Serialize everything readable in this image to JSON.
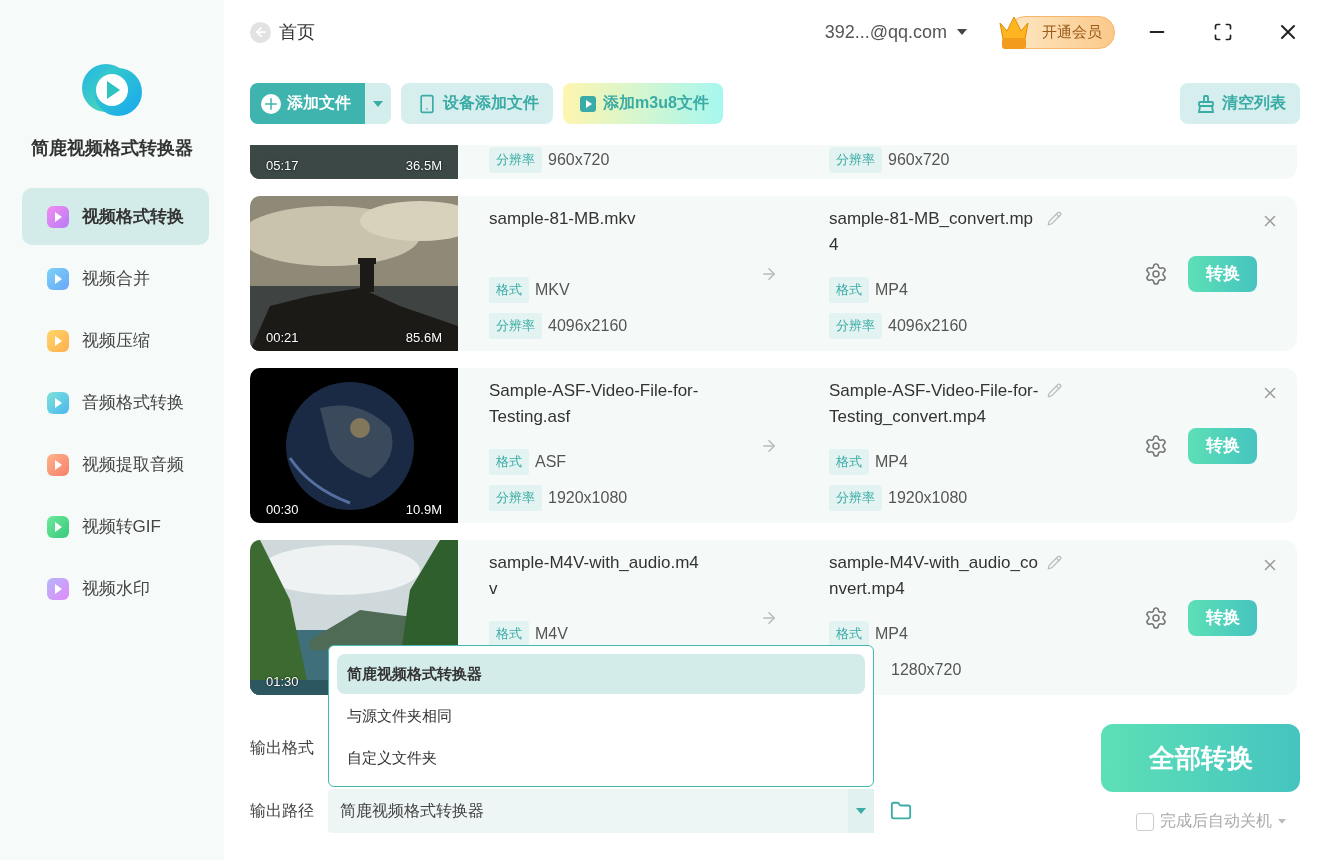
{
  "app": {
    "name": "简鹿视频格式转换器"
  },
  "sidebar": {
    "items": [
      {
        "label": "视频格式转换",
        "selected": true
      },
      {
        "label": "视频合并",
        "selected": false
      },
      {
        "label": "视频压缩",
        "selected": false
      },
      {
        "label": "音频格式转换",
        "selected": false
      },
      {
        "label": "视频提取音频",
        "selected": false
      },
      {
        "label": "视频转GIF",
        "selected": false
      },
      {
        "label": "视频水印",
        "selected": false
      }
    ]
  },
  "topbar": {
    "back_label": "首页",
    "account": "392...@qq.com",
    "vip_label": "开通会员"
  },
  "toolbar": {
    "add_file": "添加文件",
    "add_device": "设备添加文件",
    "add_m3u8": "添加m3u8文件",
    "clear": "清空列表"
  },
  "files": [
    {
      "kind": "clipped",
      "duration": "05:17",
      "size": "36.5M",
      "source": {
        "resolution_tag": "分辨率",
        "resolution": "960x720"
      },
      "target": {
        "resolution_tag": "分辨率",
        "resolution": "960x720"
      }
    },
    {
      "kind": "full",
      "duration": "00:21",
      "size": "85.6M",
      "source": {
        "name": "sample-81-MB.mkv",
        "format_tag": "格式",
        "format": "MKV",
        "resolution_tag": "分辨率",
        "resolution": "4096x2160"
      },
      "target": {
        "name": "sample-81-MB_convert.mp4",
        "format_tag": "格式",
        "format": "MP4",
        "resolution_tag": "分辨率",
        "resolution": "4096x2160"
      },
      "convert_label": "转换"
    },
    {
      "kind": "full",
      "duration": "00:30",
      "size": "10.9M",
      "source": {
        "name": "Sample-ASF-Video-File-for-Testing.asf",
        "format_tag": "格式",
        "format": "ASF",
        "resolution_tag": "分辨率",
        "resolution": "1920x1080"
      },
      "target": {
        "name": "Sample-ASF-Video-File-for-Testing_convert.mp4",
        "format_tag": "格式",
        "format": "MP4",
        "resolution_tag": "分辨率",
        "resolution": "1920x1080"
      },
      "convert_label": "转换"
    },
    {
      "kind": "full",
      "duration": "01:30",
      "source": {
        "name": "sample-M4V-with_audio.m4v",
        "format_tag": "格式",
        "format": "M4V"
      },
      "target": {
        "name": "sample-M4V-with_audio_convert.mp4",
        "format_tag": "格式",
        "format": "MP4",
        "resolution": "1280x720"
      },
      "convert_label": "转换"
    }
  ],
  "output": {
    "format_label": "输出格式",
    "path_label": "输出路径",
    "path": {
      "value": "简鹿视频格式转换器",
      "open": true
    },
    "options": [
      {
        "label": "简鹿视频格式转换器",
        "selected": true
      },
      {
        "label": "与源文件夹相同",
        "selected": false
      },
      {
        "label": "自定义文件夹",
        "selected": false
      }
    ]
  },
  "convert_all": "全部转换",
  "shutdown": {
    "label": "完成后自动关机",
    "checked": false
  }
}
